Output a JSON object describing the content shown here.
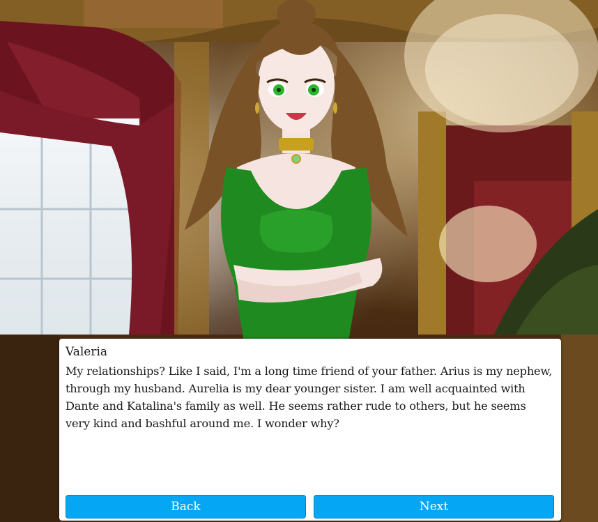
{
  "dialog": {
    "speaker": "Valeria",
    "text": "My relationships? Like I said, I'm a long time friend of your father. Arius is my nephew, through my husband. Aurelia is my dear younger sister. I am well acquainted with Dante and Katalina's family as well. He seems rather rude to others, but he seems very kind and bashful around me. I wonder why?"
  },
  "buttons": {
    "back_label": "Back",
    "next_label": "Next"
  },
  "colors": {
    "button_bg": "#05a7f5",
    "dialog_bg": "#ffffff",
    "dress": "#1f8a1f",
    "hair": "#7a5228"
  }
}
